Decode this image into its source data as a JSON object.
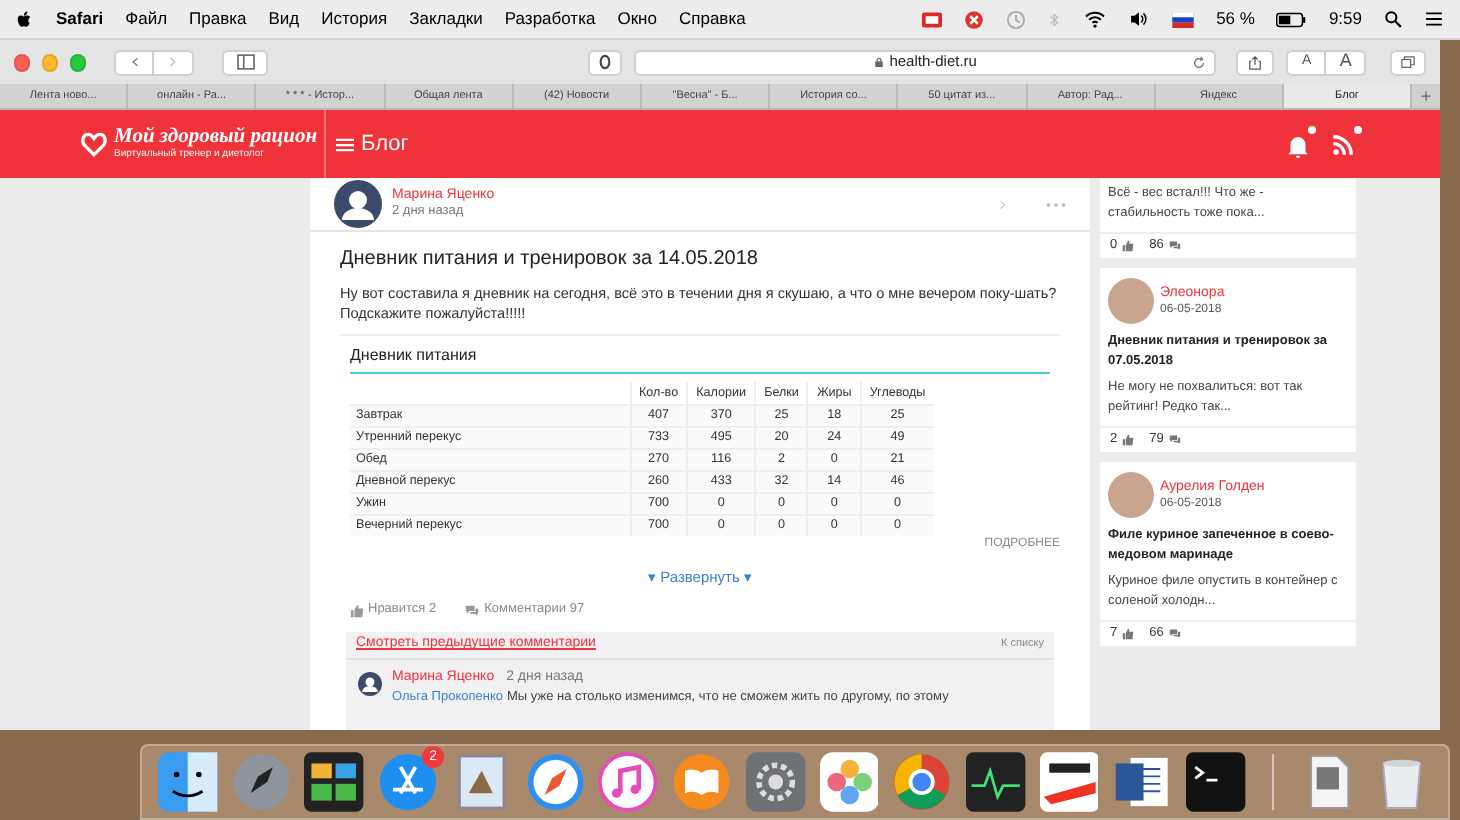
{
  "menu_bar": {
    "app": "Safari",
    "items": [
      "Файл",
      "Правка",
      "Вид",
      "История",
      "Закладки",
      "Разработка",
      "Окно",
      "Справка"
    ],
    "battery": "56 %",
    "time": "9:59"
  },
  "toolbar": {
    "address": "health-diet.ru",
    "font_buttons": [
      "A",
      "A"
    ]
  },
  "tabs": [
    {
      "label": "Лента ново...",
      "selected": false
    },
    {
      "label": "онлайн - Ра...",
      "selected": false
    },
    {
      "label": "* * * - Истор...",
      "selected": false
    },
    {
      "label": "Общая лента",
      "selected": false
    },
    {
      "label": "(42) Новости",
      "selected": false
    },
    {
      "label": "\"Весна\" - Б...",
      "selected": false
    },
    {
      "label": "История со...",
      "selected": false
    },
    {
      "label": "50 цитат из...",
      "selected": false
    },
    {
      "label": "Автор: Рад...",
      "selected": false
    },
    {
      "label": "Яндекс",
      "selected": false
    },
    {
      "label": "Блог",
      "selected": true
    }
  ],
  "new_tab": "+",
  "site_header": {
    "logo_title": "Мой здоровый рацион",
    "logo_subtitle": "Виртуальный тренер и диетолог",
    "section": "Блог"
  },
  "post": {
    "author": "Марина Яценко",
    "time": "2 дня назад",
    "title": "Дневник питания и тренировок за 14.05.2018",
    "text": "Ну вот составила я дневник на сегодня, всё это в течении дня я скушаю, а что о мне вечером поку-шать? Подскажите пожалуйста!!!!!",
    "diary": {
      "title": "Дневник питания",
      "columns": [
        "",
        "Кол-во",
        "Калории",
        "Белки",
        "Жиры",
        "Углеводы"
      ],
      "rows": [
        [
          "Завтрак",
          "407",
          "370",
          "25",
          "18",
          "25"
        ],
        [
          "Утренний перекус",
          "733",
          "495",
          "20",
          "24",
          "49"
        ],
        [
          "Обед",
          "270",
          "116",
          "2",
          "0",
          "21"
        ],
        [
          "Дневной перекус",
          "260",
          "433",
          "32",
          "14",
          "46"
        ],
        [
          "Ужин",
          "700",
          "0",
          "0",
          "0",
          "0"
        ],
        [
          "Вечерний перекус",
          "700",
          "0",
          "0",
          "0",
          "0"
        ]
      ],
      "more": "ПОДРОБНЕЕ"
    },
    "expand": "▾ Развернуть ▾",
    "likes": "Нравится 2",
    "comments": "Комментарии 97",
    "previous_comments": "Смотреть предыдущие комментарии",
    "to_list": "К списку",
    "comment": {
      "author": "Марина Яценко",
      "time": "2 дня назад",
      "reply_to": "Ольга Прокопенко",
      "text": "Мы уже на столько изменимся, что не сможем жить по другому, по этому"
    }
  },
  "sidebar": [
    {
      "text": "Всё - вес встал!!! Что же - стабильность тоже пока...",
      "likes": "0",
      "comments": "86"
    },
    {
      "author": "Элеонора",
      "date": "06-05-2018",
      "title": "Дневник питания и тренировок за 07.05.2018",
      "text": "Не могу не похвалиться: вот так рейтинг! Редко так...",
      "likes": "2",
      "comments": "79"
    },
    {
      "author": "Аурелия Голден",
      "date": "06-05-2018",
      "title": "Филе куриное запеченное в соево-медовом маринаде",
      "text": "Куриное филе опустить в контейнер с соленой холодн...",
      "likes": "7",
      "comments": "66"
    }
  ],
  "dock": {
    "badge": "2"
  }
}
